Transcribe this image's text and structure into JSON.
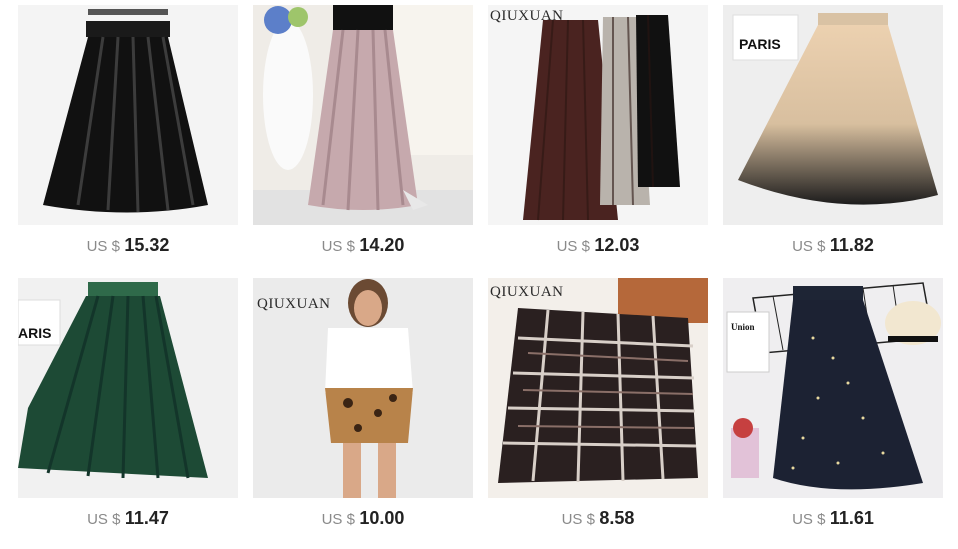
{
  "products": [
    {
      "currency": "US $",
      "price": "15.32",
      "image": "black-pleated-satin-skirt"
    },
    {
      "currency": "US $",
      "price": "14.20",
      "image": "mauve-pleated-maxi-skirt"
    },
    {
      "currency": "US $",
      "price": "12.03",
      "image": "three-velvet-pleated-skirts",
      "brand": "QIUXUAN"
    },
    {
      "currency": "US $",
      "price": "11.82",
      "image": "ombre-tulle-skirt",
      "tag": "PARIS"
    },
    {
      "currency": "US $",
      "price": "11.47",
      "image": "green-pleated-midi-skirt",
      "tag": "ARIS"
    },
    {
      "currency": "US $",
      "price": "10.00",
      "image": "leopard-mini-skirt",
      "brand": "QIUXUAN"
    },
    {
      "currency": "US $",
      "price": "8.58",
      "image": "plaid-tweed-mini-skirt",
      "brand": "QIUXUAN"
    },
    {
      "currency": "US $",
      "price": "11.61",
      "image": "navy-sequin-tulle-skirt",
      "tag": "Union"
    }
  ],
  "colors": {
    "price_text": "#222222",
    "currency_text": "#8a8a8a",
    "background": "#ffffff"
  }
}
